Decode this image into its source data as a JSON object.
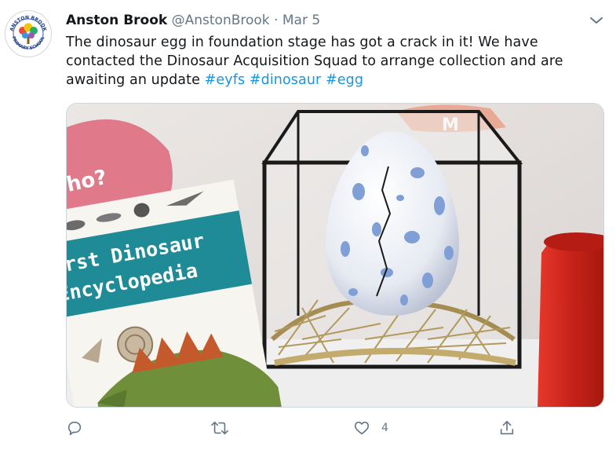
{
  "tweet": {
    "display_name": "Anston Brook",
    "handle": "@AnstonBrook",
    "separator": "·",
    "date": "Mar 5",
    "text_parts": [
      "The dinosaur egg in foundation stage has got a crack in it! We have contacted the Dinosaur Acquisition Squad to arrange collection and are awaiting an update ",
      "#eyfs",
      " ",
      "#dinosaur",
      " ",
      "#egg"
    ]
  },
  "avatar": {
    "top_text": "ANSTON BROOK",
    "bottom_text": "PRIMARY SCHOOL"
  },
  "media": {
    "book_title_line1": "irst Dinosaur",
    "book_title_line2": "Encyclopedia",
    "poster_text": "ho?",
    "wall_text": "M"
  },
  "actions": {
    "reply_icon": "reply-icon",
    "retweet_icon": "retweet-icon",
    "like_icon": "heart-icon",
    "like_count": "4",
    "share_icon": "share-icon"
  },
  "colors": {
    "link": "#1b95e0",
    "secondary_text": "#657786",
    "book_teal": "#1e8b97",
    "egg_spots": "#7f9fd6",
    "red_cup": "#d8281e"
  }
}
